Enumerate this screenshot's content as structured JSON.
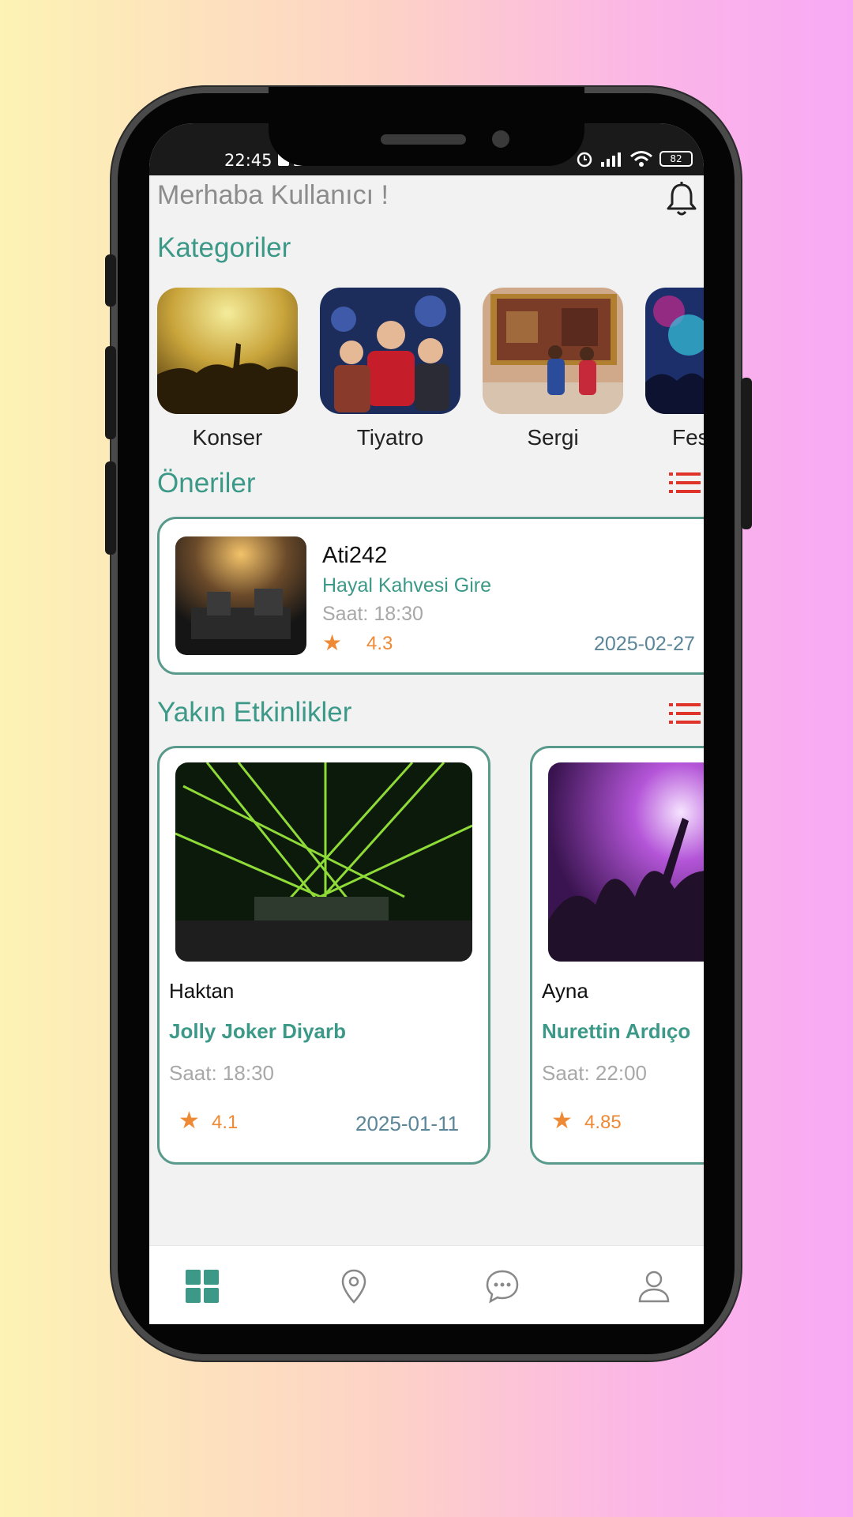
{
  "status_bar": {
    "time": "22:45",
    "battery": "82"
  },
  "header": {
    "greeting": "Merhaba Kullanıcı !",
    "icon": "bell-icon"
  },
  "categories": {
    "title": "Kategoriler",
    "items": [
      {
        "label": "Konser"
      },
      {
        "label": "Tiyatro"
      },
      {
        "label": "Sergi"
      },
      {
        "label": "Fes"
      }
    ]
  },
  "recommendations": {
    "title": "Öneriler",
    "items": [
      {
        "name": "Ati242",
        "venue": "Hayal Kahvesi Gire",
        "time": "Saat: 18:30",
        "rating": "4.3",
        "date": "2025-02-27"
      }
    ]
  },
  "nearby": {
    "title": "Yakın Etkinlikler",
    "items": [
      {
        "name": "Haktan",
        "venue": "Jolly Joker Diyarb",
        "time": "Saat: 18:30",
        "rating": "4.1",
        "date": "2025-01-11"
      },
      {
        "name": "Ayna",
        "venue": "Nurettin Ardıço",
        "time": "Saat: 22:00",
        "rating": "4.85",
        "date": ""
      }
    ]
  },
  "colors": {
    "accent": "#3c9988",
    "star": "#ee8a35",
    "list_icon": "#e0342b",
    "date": "#5b8599"
  },
  "bottom_nav": {
    "items": [
      "grid-icon",
      "location-pin-icon",
      "chat-icon",
      "profile-icon"
    ]
  }
}
